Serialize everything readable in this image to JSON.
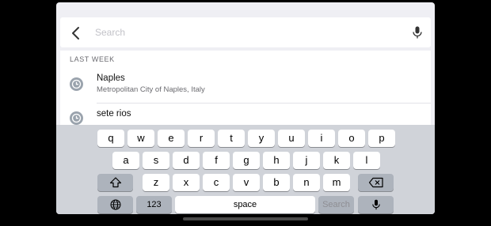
{
  "search": {
    "placeholder": "Search"
  },
  "recents": {
    "section_header": "LAST WEEK",
    "items": [
      {
        "title": "Naples",
        "subtitle": "Metropolitan City of Naples, Italy",
        "icon": "clock-icon"
      },
      {
        "title": "sete rios",
        "subtitle": "",
        "icon": "clock-icon"
      }
    ]
  },
  "keyboard": {
    "row1": [
      "q",
      "w",
      "e",
      "r",
      "t",
      "y",
      "u",
      "i",
      "o",
      "p"
    ],
    "row2": [
      "a",
      "s",
      "d",
      "f",
      "g",
      "h",
      "j",
      "k",
      "l"
    ],
    "row3": [
      "z",
      "x",
      "c",
      "v",
      "b",
      "n",
      "m"
    ],
    "shift_icon": "shift-icon",
    "backspace_icon": "backspace-icon",
    "globe_icon": "globe-icon",
    "numbers_label": "123",
    "space_label": "space",
    "search_label": "Search",
    "mic_icon": "microphone-icon"
  },
  "colors": {
    "keyboard_bg": "#d0d3d9",
    "key_light": "#ffffff",
    "key_dark": "#adb3bc",
    "clock_icon": "#9aa3ad"
  }
}
